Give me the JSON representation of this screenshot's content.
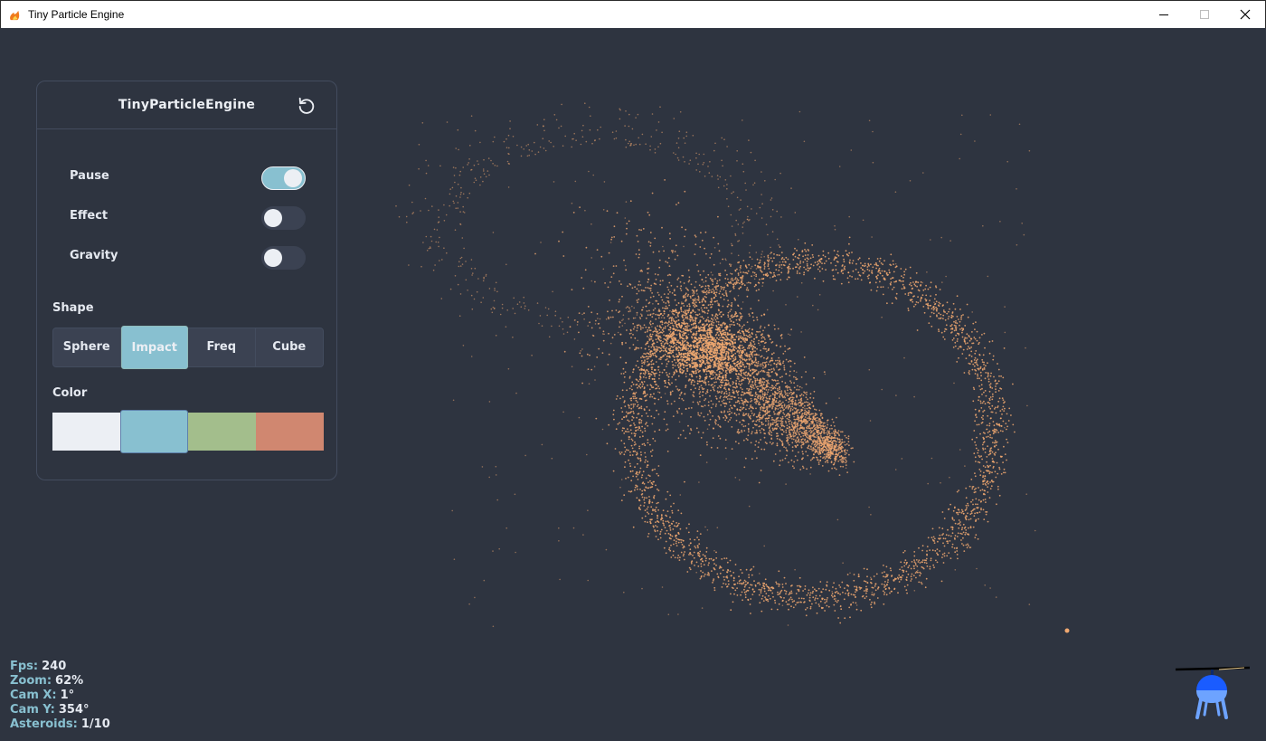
{
  "window": {
    "title": "Tiny Particle Engine",
    "icon": "flame-icon",
    "controls": [
      "minimize-icon",
      "maximize-icon",
      "close-icon"
    ]
  },
  "panel": {
    "title": "TinyParticleEngine",
    "reset_icon": "reset-icon",
    "toggles": [
      {
        "label": "Pause",
        "on": true
      },
      {
        "label": "Effect",
        "on": false
      },
      {
        "label": "Gravity",
        "on": false
      }
    ],
    "shape": {
      "label": "Shape",
      "options": [
        "Sphere",
        "Impact",
        "Freq",
        "Cube"
      ],
      "selected": "Impact"
    },
    "color": {
      "label": "Color",
      "swatches": [
        "#eceff4",
        "#88c0d0",
        "#a3be8c",
        "#d08770"
      ],
      "selected_index": 1
    }
  },
  "stats": {
    "fps_label": "Fps:",
    "fps": "240",
    "zoom_label": "Zoom:",
    "zoom": "62%",
    "camx_label": "Cam X:",
    "camx": "1°",
    "camy_label": "Cam Y:",
    "camy": "354°",
    "asteroids_label": "Asteroids:",
    "asteroids": "1/10"
  },
  "colors": {
    "background": "#2e3440",
    "particle": "#f0a870",
    "accent": "#88c0d0"
  },
  "mascot_icon": "helicopter-icon"
}
